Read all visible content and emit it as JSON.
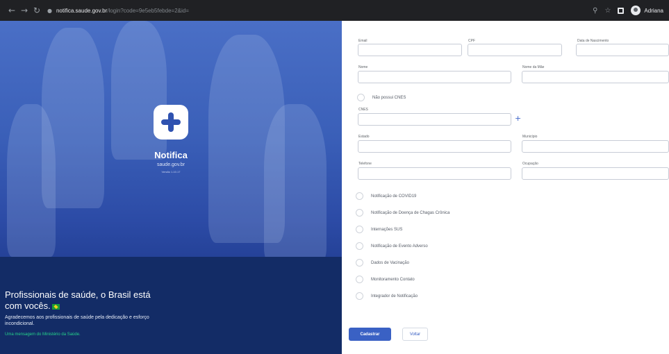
{
  "browser": {
    "url_host": "notifica.saude.gov.br",
    "url_path": "/login?code=9e5eb5febde=2&id=",
    "profile_name": "Adriana"
  },
  "hero": {
    "brand_name": "Notifica",
    "brand_domain": "saude.gov.br",
    "brand_version": "Versão 1.10.17",
    "title": "Profissionais de saúde, o Brasil está com vocês.",
    "subtitle": "Agradecemos aos profissionais de saúde pela dedicação e esforço incondicional.",
    "message": "Uma mensagem do Ministério da Saúde."
  },
  "form": {
    "labels": {
      "email": "Email",
      "cpf": "CPF",
      "birth_date": "Data de Nascimento",
      "name": "Nome",
      "mother_name": "Nome da Mãe",
      "no_cnes": "Não possui CNES",
      "cnes": "CNES",
      "state": "Estado",
      "city": "Município",
      "phone": "Telefone",
      "occupation": "Ocupação"
    },
    "options": [
      "Notificação de COVID19",
      "Notificação de Doença de Chagas Crônica",
      "Internações SUS",
      "Notificação de Evento Adverso",
      "Dados de Vacinação",
      "Monitoramento Contato",
      "Integrador de Notificação"
    ],
    "submit_label": "Cadastrar",
    "back_label": "Voltar"
  },
  "colors": {
    "primary": "#3a61c4",
    "hero_dark": "#132c66",
    "accent_green": "#25d38a"
  }
}
